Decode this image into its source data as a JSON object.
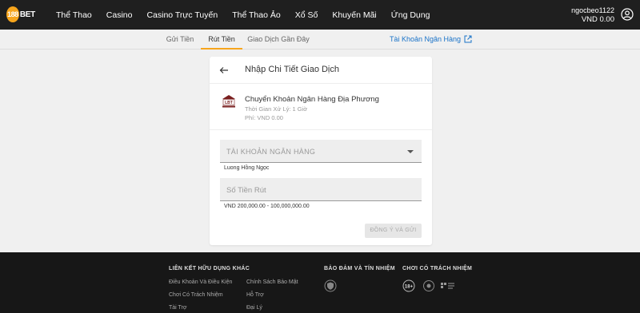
{
  "header": {
    "logo_number": "188",
    "logo_text": "BET",
    "nav": [
      "Thể Thao",
      "Casino",
      "Casino Trực Tuyến",
      "Thể Thao Ảo",
      "Xổ Số",
      "Khuyến Mãi",
      "Ứng Dụng"
    ],
    "username": "ngocbeo1122",
    "balance": "VND 0.00"
  },
  "subtabs": {
    "deposit": "Gửi Tiền",
    "withdraw": "Rút Tiền",
    "history": "Giao Dịch Gần Đây",
    "bank_account": "Tài Khoản Ngân Hàng"
  },
  "card": {
    "title": "Nhập Chi Tiết Giao Dịch",
    "method": {
      "icon_text": "LBT",
      "name": "Chuyển Khoản Ngân Hàng Địa Phương",
      "processing_time": "Thời Gian Xử Lý: 1 Giờ",
      "fee": "Phí: VND 0.00"
    },
    "bank_field_label": "TÀI KHOẢN NGÂN HÀNG",
    "bank_field_hint": "Luong Hồng Ngọc",
    "amount_field_label": "Số Tiền Rút",
    "amount_hint": "VND 200,000.00 - 100,000,000.00",
    "submit_label": "ĐỒNG Ý VÀ GỬI"
  },
  "footer": {
    "useful_links_title": "LIÊN KẾT HỮU DỤNG KHÁC",
    "links": [
      "Điều Khoản Và Điều Kiện",
      "Chính Sách Bảo Mật",
      "Chơi Có Trách Nhiệm",
      "Hỗ Trợ",
      "Tài Trợ",
      "Đại Lý"
    ],
    "security_title": "BẢO ĐẢM VÀ TÍN NHIỆM",
    "responsible_title": "CHƠI CÓ TRÁCH NHIỆM",
    "age_badge": "18+"
  },
  "colors": {
    "accent": "#f7a51c",
    "link": "#1a73c8",
    "topbar": "#1f1f1f",
    "footer": "#171717"
  }
}
